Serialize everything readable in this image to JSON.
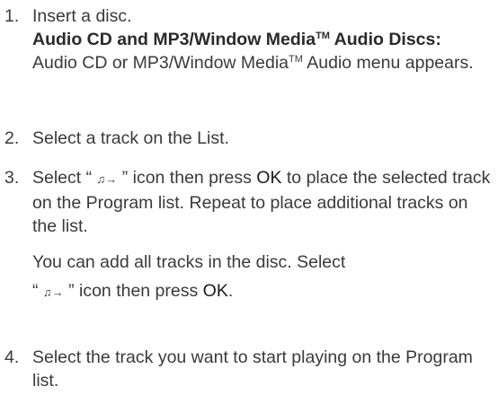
{
  "steps": [
    {
      "num": "1.",
      "text": "Insert a disc.",
      "heading_1": "Audio CD and MP3/Window Media",
      "heading_tm": "TM",
      "heading_2": " Audio Discs:",
      "detail_1": "Audio CD or MP3/Window Media",
      "detail_tm": "TM",
      "detail_2": " Audio menu appears."
    },
    {
      "num": "2.",
      "text": "Select a track on the List."
    },
    {
      "num": "3.",
      "pre": "Select “ ",
      "icon": "♫→",
      "post": " ” icon then press ",
      "ok": "OK",
      "rest": " to place the selected track on the Program list. Repeat to place additional tracks on the list.",
      "note_pre": "You can add all tracks in the disc. Select",
      "note_q": "“ ",
      "note_icon": "♫→",
      "note_post": " ” icon then press ",
      "note_ok": "OK",
      "note_end": "."
    },
    {
      "num": "4.",
      "text": "Select the track you want to start playing on the Program list."
    }
  ],
  "icons": {
    "add_track": "add-track-icon",
    "add_all_tracks": "add-all-tracks-icon"
  }
}
